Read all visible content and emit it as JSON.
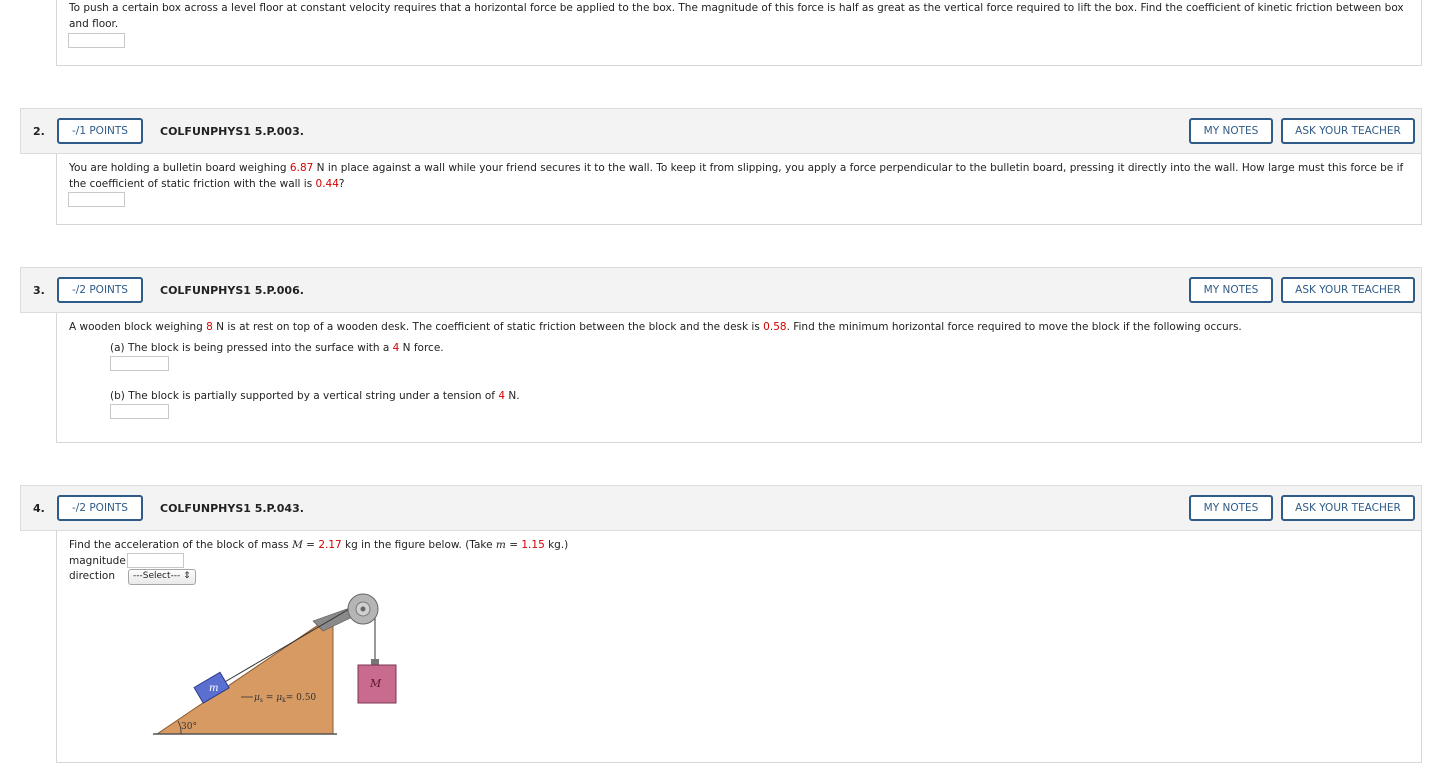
{
  "q1": {
    "text": "To push a certain box across a level floor at constant velocity requires that a horizontal force be applied to the box. The magnitude of this force is half as great as the vertical force required to lift the box. Find the coefficient of kinetic friction between box and floor."
  },
  "q2": {
    "number": "2.",
    "points": "-/1 POINTS",
    "id": "COLFUNPHYS1 5.P.003.",
    "notes_label": "MY NOTES",
    "ask_label": "ASK YOUR TEACHER",
    "t1": "You are holding a bulletin board weighing ",
    "weight": "6.87",
    "t2": " N in place against a wall while your friend secures it to the wall. To keep it from slipping, you apply a force perpendicular to the bulletin board, pressing it directly into the wall. How large must this force be if the coefficient of static friction with the wall is ",
    "mu": "0.44",
    "t3": "?"
  },
  "q3": {
    "number": "3.",
    "points": "-/2 POINTS",
    "id": "COLFUNPHYS1 5.P.006.",
    "notes_label": "MY NOTES",
    "ask_label": "ASK YOUR TEACHER",
    "t1": "A wooden block weighing ",
    "weight": "8",
    "t2": " N is at rest on top of a wooden desk. The coefficient of static friction between the block and the desk is ",
    "mu": "0.58",
    "t3": ". Find the minimum horizontal force required to move the block if the following occurs.",
    "a1": "(a) The block is being pressed into the surface with a ",
    "a_force": "4",
    "a2": " N force.",
    "b1": "(b) The block is partially supported by a vertical string under a tension of ",
    "b_force": "4",
    "b2": " N."
  },
  "q4": {
    "number": "4.",
    "points": "-/2 POINTS",
    "id": "COLFUNPHYS1 5.P.043.",
    "notes_label": "MY NOTES",
    "ask_label": "ASK YOUR TEACHER",
    "t1": "Find the acceleration of the block of mass ",
    "mass_var": "M",
    "t2": " = ",
    "M_value": "2.17",
    "t3": " kg in the figure below. (Take ",
    "m_var": "m",
    "t4": " = ",
    "m_value": "1.15",
    "t5": " kg.)",
    "magnitude_label": "magnitude",
    "direction_label": "direction",
    "select_value": "---Select---",
    "figure": {
      "small_block": "m",
      "big_block": "M",
      "friction": "= 0.50",
      "angle": "30°"
    }
  },
  "colors": {
    "accent": "#2e5b87",
    "given_value": "#d40000",
    "ramp": "#d89a63",
    "block_m": "#5b6fd0",
    "block_M": "#c96b8e"
  }
}
